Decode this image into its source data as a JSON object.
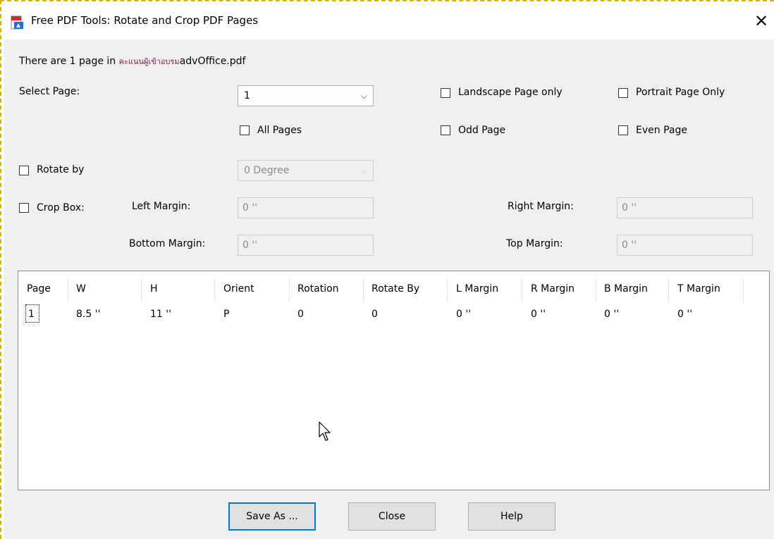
{
  "window": {
    "title": "Free PDF Tools: Rotate and Crop PDF Pages",
    "close_glyph": "✕",
    "icon": "pdf-tool-icon"
  },
  "info": {
    "text_prefix": "There are 1 page in ",
    "filename_thai": "คะแนนผู้เข้าอบรม",
    "filename_rest": "advOffice.pdf"
  },
  "select_page": {
    "label": "Select Page:",
    "value": "1"
  },
  "options": {
    "landscape_only": "Landscape Page only",
    "portrait_only": "Portrait Page Only",
    "all_pages": "All Pages",
    "odd_page": "Odd Page",
    "even_page": "Even Page"
  },
  "rotate": {
    "label": "Rotate by",
    "value": "0 Degree"
  },
  "crop": {
    "label": "Crop Box:",
    "left_margin_label": "Left Margin:",
    "left_margin_value": "0 ''",
    "right_margin_label": "Right Margin:",
    "right_margin_value": "0 ''",
    "bottom_margin_label": "Bottom Margin:",
    "bottom_margin_value": "0 ''",
    "top_margin_label": "Top Margin:",
    "top_margin_value": "0 ''"
  },
  "table": {
    "columns": [
      "Page",
      "W",
      "H",
      "Orient",
      "Rotation",
      "Rotate By",
      "L Margin",
      "R Margin",
      "B Margin",
      "T Margin"
    ],
    "rows": [
      [
        "1",
        "8.5 ''",
        "11 ''",
        "P",
        "0",
        "0",
        "0 ''",
        "0 ''",
        "0 ''",
        "0 ''"
      ]
    ]
  },
  "buttons": {
    "save_as": "Save As ...",
    "close": "Close",
    "help": "Help"
  },
  "colors": {
    "accent": "#0078d7",
    "dialog_bg": "#f0f0f0",
    "dashed_border": "#d9b200"
  }
}
